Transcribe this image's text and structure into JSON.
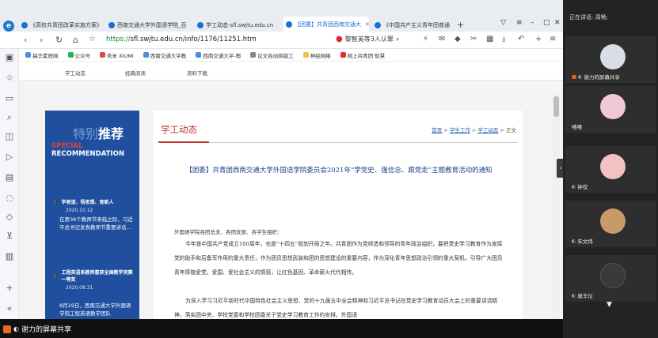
{
  "browser": {
    "tabs": [
      {
        "label": "《高校共青团改革实施方案》"
      },
      {
        "label": "西南交通大学外国语学院_百"
      },
      {
        "label": "学工动态-sfl.swjtu.edu.cn"
      },
      {
        "label": "【团委】共青团西南交通大",
        "active": true
      },
      {
        "label": "《中国共产主义青年团普通"
      }
    ],
    "new_tab": "+",
    "url_scheme": "https://",
    "url_rest": "sfl.swjtu.edu.cn/info/1176/11251.htm",
    "search_text": "黎智英等3人认罪",
    "bookmarks": [
      "搞华素质网",
      "公众号",
      "秀米 XIUMI",
      "西南交通大学教",
      "西南交通大学-郫",
      "论文自动排版工",
      "神经网络",
      "网上共青团·智慧"
    ]
  },
  "page": {
    "site_nav": [
      "学工动态",
      "经典阅读",
      "资料下载"
    ],
    "reco": {
      "title_faded": "特别",
      "title": "推荐",
      "en_line1": "SPECIAL",
      "en_line2": "RECOMMENDATION",
      "items": [
        {
          "title": "学者道、悟思想、育新人",
          "date": "2020.10.12",
          "text": "在第36个教师节来临之际，习近平总书记发表教师节重要讲话…"
        },
        {
          "title": "工程英语系教师喜获全国教学竞赛一等奖",
          "date": "2020.08.31",
          "text": "8月19日，西南交通大学外国语学院工程英语教学团队"
        }
      ]
    },
    "section_title": "学工动态",
    "breadcrumb": {
      "home": "首页",
      "sep": " > ",
      "l2": "学生工作",
      "l3": "学工动态",
      "current": "正文"
    },
    "headline": "【团委】共青团西南交通大学外国语学院委员会2021年“学党史、强信念、跟党走”主题教育活动的通知",
    "greeting": "外国语学院各团总支、各团支部、各学生组织：",
    "para1": "今年是中国共产党成立100周年，也是“十四五”规划开局之年。共青团作为党缔造和领导的青年政治组织，要把党史学习教育作为发挥党的助手和后备军作用的重大责任，作为团员思想武装和团的思想建设的重要内容，作为深化青年思想政治引领的重大契机，引导广大团员青年厚植爱党、爱国、爱社会主义的情感，让红色基因、革命薪火代代相传。",
    "para2": "为深入学习习近平新时代中国特色社会主义思想、党的十九届五中全会精神和习近平总书记在党史学习教育动员大会上的重要讲话精神，落实团中央、学校党委和学校团委关于党史学习教育工作的安排，外国语"
  },
  "meeting": {
    "speaking": "正在讲话: 周畅;",
    "participants": [
      {
        "name": "谢力的屏幕共享",
        "color": "#d8dde6"
      },
      {
        "name": "嘻嘻",
        "color": "#f0c8d6"
      },
      {
        "name": "钟佼",
        "color": "#f2c2c2"
      },
      {
        "name": "朱文炜",
        "color": "#c89a6a"
      },
      {
        "name": "唐丰仪",
        "color": "#3a3a3a"
      }
    ],
    "bottom_share": "谢力的屏幕共享"
  }
}
